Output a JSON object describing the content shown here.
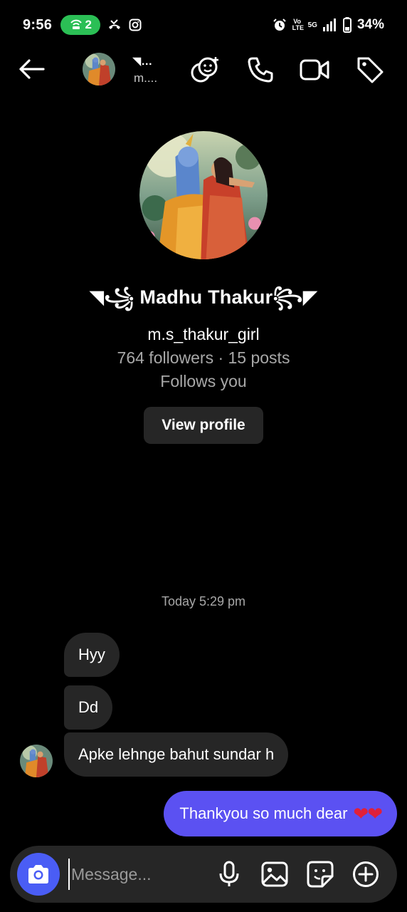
{
  "status_bar": {
    "time": "9:56",
    "hotspot_count": "2",
    "battery": "34%",
    "network_label": "Vo LTE",
    "network_type": "5G",
    "icons": [
      "hotspot-icon",
      "missed-call-icon",
      "instagram-icon",
      "alarm-icon",
      "signal-icon",
      "battery-icon"
    ]
  },
  "header": {
    "name_short": "◥…",
    "username_short": "m....",
    "icons": [
      "back-arrow-icon",
      "effects-icon",
      "phone-icon",
      "video-icon",
      "tag-icon"
    ]
  },
  "profile": {
    "display_name": "◥꧁ Madhu Thakur꧂◤",
    "username": "m.s_thakur_girl",
    "stats": "764 followers · 15 posts",
    "follows_you": "Follows you",
    "view_profile_label": "View profile"
  },
  "messages": {
    "timestamp": "Today 5:29 pm",
    "incoming": [
      "Hyy",
      "Dd",
      "Apke lehnge bahut sundar h"
    ],
    "outgoing": {
      "text": "Thankyou so much dear",
      "emoji": "❤❤"
    }
  },
  "composer": {
    "placeholder": "Message...",
    "icons": [
      "camera-icon",
      "microphone-icon",
      "gallery-icon",
      "sticker-icon",
      "plus-icon"
    ]
  },
  "colors": {
    "background": "#000000",
    "incoming_bubble": "#262626",
    "outgoing_bubble": "#5b51f2",
    "camera_button": "#4a5df5",
    "hotspot_pill": "#2bbf55",
    "heart": "#e0203a"
  }
}
